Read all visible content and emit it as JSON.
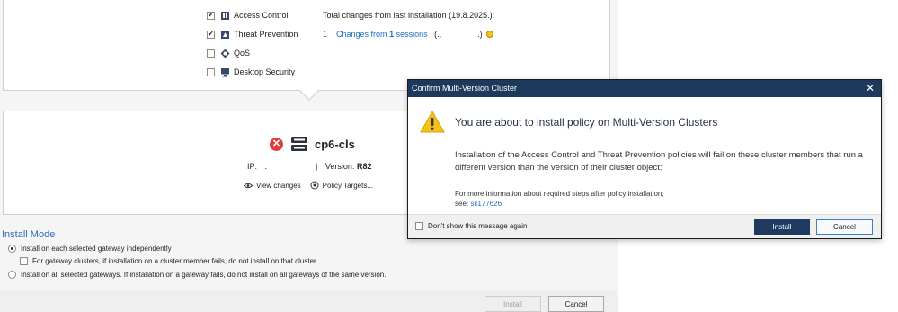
{
  "policy_panel": {
    "blades": [
      {
        "label": "Access Control",
        "checked": true,
        "icon": "access-control-icon"
      },
      {
        "label": "Threat Prevention",
        "checked": true,
        "icon": "threat-prevention-icon"
      },
      {
        "label": "QoS",
        "checked": false,
        "icon": "qos-icon"
      },
      {
        "label": "Desktop Security",
        "checked": false,
        "icon": "desktop-security-icon"
      }
    ],
    "changes": {
      "title": "Total changes from last installation (19.8.2025.):",
      "count": "1",
      "link_prefix": "Changes from",
      "sessions_count": "1",
      "sessions_label": "sessions",
      "session_owner": "(.,",
      "session_suffix": ".)"
    },
    "gateway": {
      "name": "cp6-cls",
      "status": "error",
      "ip_label": "IP:",
      "ip_value": ".",
      "version_label": "Version:",
      "version_value": "R82",
      "view_changes": "View changes",
      "policy_targets": "Policy Targets..."
    },
    "install_mode": {
      "title": "Install Mode",
      "option_independent": "Install on each selected gateway independently",
      "option_cluster_sub": "For gateway clusters, if installation on a cluster member fails, do not install on that cluster.",
      "option_all": "Install on all selected gateways. If installation on a gateway fails, do not install on all gateways of the same version.",
      "selected": "independent"
    },
    "buttons": {
      "install": "Install",
      "cancel": "Cancel"
    }
  },
  "dialog": {
    "title": "Confirm Multi-Version Cluster",
    "close": "✕",
    "heading": "You are about to install policy on Multi-Version Clusters",
    "body": "Installation of the Access Control and Threat Prevention policies will fail on these cluster members that run a different version than the version of their cluster object:",
    "info_line1": "For more information about required steps after policy installation,",
    "info_see": "see:",
    "info_link": "sk177626",
    "dont_show": "Don't show this message again",
    "install": "Install",
    "cancel": "Cancel"
  },
  "colors": {
    "accent": "#1f6fbf",
    "dialog_titlebar": "#1d3a5c",
    "primary_button": "#1e3a5f",
    "error": "#e03c3c",
    "warning": "#f2c21b"
  }
}
